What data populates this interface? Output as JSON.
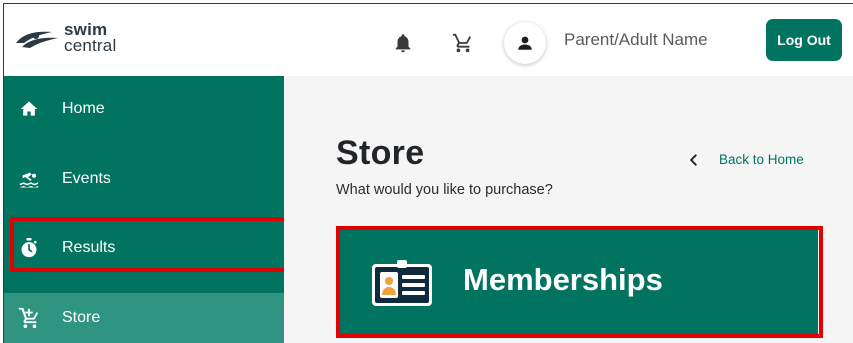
{
  "brand": {
    "line1": "swim",
    "line2": "central"
  },
  "header": {
    "user_name": "Parent/Adult Name",
    "logout_label": "Log Out",
    "icons": [
      "bell-icon",
      "cart-icon",
      "user-icon"
    ]
  },
  "sidebar": {
    "items": [
      {
        "label": "Home",
        "icon": "home-icon"
      },
      {
        "label": "Events",
        "icon": "swimmer-icon"
      },
      {
        "label": "Results",
        "icon": "stopwatch-icon"
      },
      {
        "label": "Store",
        "icon": "add-cart-icon",
        "selected": true
      }
    ]
  },
  "main": {
    "title": "Store",
    "subtitle": "What would you like to purchase?",
    "back_label": "Back to Home",
    "cards": [
      {
        "label": "Memberships",
        "icon": "id-card-icon"
      }
    ]
  },
  "colors": {
    "accent": "#007460",
    "selected": "#2f9580",
    "highlight": "#e00000",
    "background": "#f5f5f5"
  }
}
